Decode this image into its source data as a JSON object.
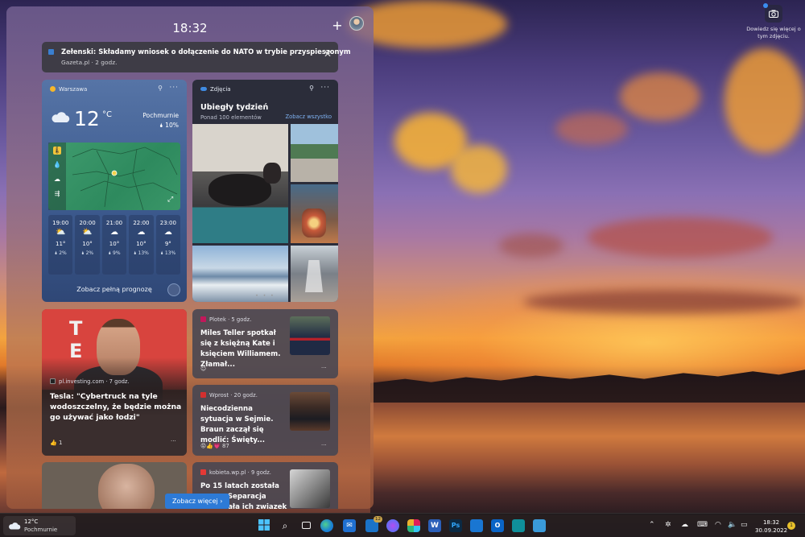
{
  "desktop": {
    "photo_info": "Dowiedz się więcej o tym zdjęciu."
  },
  "widgets": {
    "time": "18:32",
    "add_label": "+",
    "notification": {
      "title": "Zełenski: Składamy wniosek o dołączenie do NATO w trybie przyspieszonym",
      "source": "Gazeta.pl · 2 godz.",
      "close": "✕"
    },
    "weather": {
      "location": "Warszawa",
      "temp": "12",
      "unit": "°C",
      "condition": "Pochmurnie",
      "precip": "🌢 10%",
      "forecast": [
        {
          "time": "19:00",
          "icon": "partly-cloudy-icon",
          "temp": "11°",
          "precip": "🌢 2%"
        },
        {
          "time": "20:00",
          "icon": "partly-cloudy-icon",
          "temp": "10°",
          "precip": "🌢 2%"
        },
        {
          "time": "21:00",
          "icon": "cloud-icon",
          "temp": "10°",
          "precip": "🌢 9%"
        },
        {
          "time": "22:00",
          "icon": "cloud-icon",
          "temp": "10°",
          "precip": "🌢 13%"
        },
        {
          "time": "23:00",
          "icon": "cloud-icon",
          "temp": "9°",
          "precip": "🌢 13%"
        }
      ],
      "full_forecast_link": "Zobacz pełną prognozę"
    },
    "photos": {
      "app": "Zdjęcia",
      "title": "Ubiegły tydzień",
      "subtitle": "Ponad 100 elementów",
      "see_all": "Zobacz wszystko"
    },
    "news": [
      {
        "source": "pl.investing.com · 7 godz.",
        "title": "Tesla: \"Cybertruck na tyle wodoszczelny, że będzie można go używać jako łodzi\"",
        "reactions": "👍 1",
        "more": "···"
      },
      {
        "source": "Plotek · 5 godz.",
        "title": "Miles Teller spotkał się z księżną Kate i księciem Williamem. Złamał...",
        "more": "···"
      },
      {
        "source": "Wprost · 20 godz.",
        "title": "Niecodzienna sytuacja w Sejmie. Braun zaczął się modlić: Święty...",
        "reactions": "😡👍💗 87",
        "more": "···"
      },
      {
        "source": "kobieta.wp.pl · 9 godz.",
        "title": "Po 15 latach została ...ona. Separacja uratowała ich związek"
      }
    ],
    "see_more": "Zobacz więcej"
  },
  "taskbar": {
    "weather_temp": "12°C",
    "weather_condition": "Pochmurnie",
    "teams_badge": "12",
    "time": "18:32",
    "date": "30.09.2022",
    "notification_count": "1"
  },
  "colors": {
    "accent": "#2d7ad6",
    "weather_card": "#3d5b8f",
    "taskbar": "#221c1e"
  }
}
